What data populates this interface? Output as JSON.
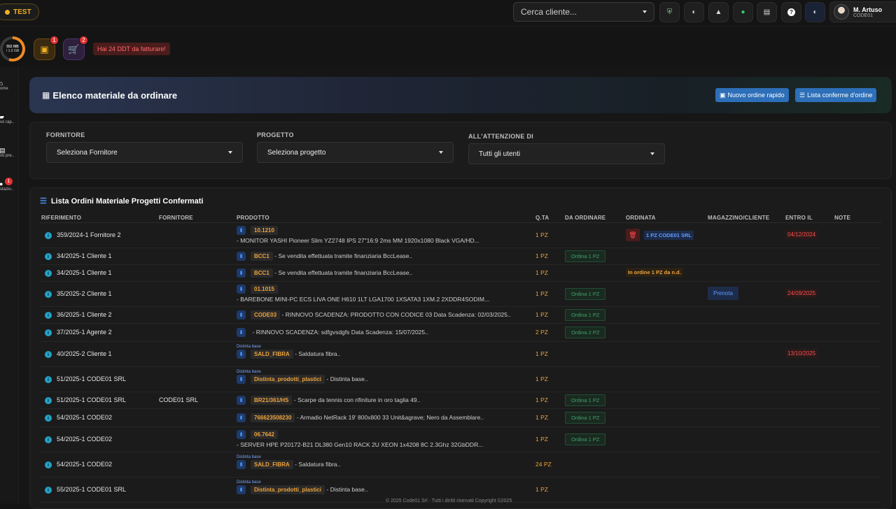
{
  "topbar": {
    "test_label": "TEST",
    "search_placeholder": "Cerca cliente...",
    "user": {
      "name": "M. Artuso",
      "code": "CODE01"
    }
  },
  "storage": {
    "used": "552 MB",
    "total": "/ 1.0 GB"
  },
  "quick": {
    "orders_badge": "1",
    "cart_badge": "2",
    "ddt_alert": "Hai 24 DDT da fatturare!"
  },
  "sidebar": [
    {
      "label": "ome",
      "badge": ""
    },
    {
      "label": "vo rap..",
      "badge": ""
    },
    {
      "label": "vo pre..",
      "badge": ""
    },
    {
      "label": "stazio..",
      "badge": "1"
    }
  ],
  "header": {
    "title": "Elenco materiale da ordinare",
    "btn_new": "Nuovo ordine rapido",
    "btn_list": "Lista conferme d'ordine"
  },
  "filters": {
    "fornitore_label": "FORNITORE",
    "fornitore_value": "Seleziona Fornitore",
    "progetto_label": "PROGETTO",
    "progetto_value": "Seleziona progetto",
    "attenzione_label": "ALL'ATTENZIONE DI",
    "attenzione_value": "Tutti gli utenti"
  },
  "list": {
    "title": "Lista Ordini Materiale Progetti Confermati",
    "columns": [
      "RIFERIMENTO",
      "FORNITORE",
      "PRODOTTO",
      "Q.TA",
      "DA ORDINARE",
      "ORDINATA",
      "MAGAZZINO/CLIENTE",
      "ENTRO IL",
      "NOTE"
    ],
    "rows": [
      {
        "ref": "359/2024-1 Fornitore 2",
        "fornitore": "",
        "distinta": "",
        "code": "10.1210",
        "desc": "- MONITOR YASHI Pioneer Slim YZ2748 IPS 27\"16:9 2ms MM 1920x1080 Black VGA/HD...",
        "qty": "1 PZ",
        "ordina": "",
        "ordinata": "1 PZ CODE01 SRL",
        "magazzino": "",
        "entro": "04/12/2024"
      },
      {
        "ref": "34/2025-1 Cliente 1",
        "fornitore": "",
        "distinta": "",
        "code": "BCC1",
        "desc": "- Se vendita effettuata tramite finanziaria BccLease..",
        "qty": "1 PZ",
        "ordina": "Ordina 1 PZ",
        "ordinata": "",
        "magazzino": "",
        "entro": ""
      },
      {
        "ref": "34/2025-1 Cliente 1",
        "fornitore": "",
        "distinta": "",
        "code": "BCC1",
        "desc": "- Se vendita effettuata tramite finanziaria BccLease..",
        "qty": "1 PZ",
        "ordina": "",
        "ordinata": "In ordine 1 PZ da n.d.",
        "magazzino": "",
        "entro": ""
      },
      {
        "ref": "35/2025-2 Cliente 1",
        "fornitore": "",
        "distinta": "",
        "code": "01.1015",
        "desc": "- BAREBONE MINI-PC ECS LIVA ONE H610 1LT LGA1700 1XSATA3 1XM.2 2XDDR4SODIM...",
        "qty": "1 PZ",
        "ordina": "Ordina 1 PZ",
        "ordinata": "",
        "magazzino": "Prenota",
        "entro": "24/09/2025"
      },
      {
        "ref": "36/2025-1 Cliente 2",
        "fornitore": "",
        "distinta": "",
        "code": "CODE03",
        "desc": "- RINNOVO SCADENZA: PRODOTTO CON CODICE 03 Data Scadenza: 02/03/2025..",
        "qty": "1 PZ",
        "ordina": "Ordina 1 PZ",
        "ordinata": "",
        "magazzino": "",
        "entro": ""
      },
      {
        "ref": "37/2025-1 Agente 2",
        "fornitore": "",
        "distinta": "",
        "code": "",
        "desc": "- RINNOVO SCADENZA: sdfgvsdgfs Data Scadenza: 15/07/2025..",
        "qty": "2 PZ",
        "ordina": "Ordina 2 PZ",
        "ordinata": "",
        "magazzino": "",
        "entro": ""
      },
      {
        "ref": "40/2025-2 Cliente 1",
        "fornitore": "",
        "distinta": "Distinta base",
        "code": "SALD_FIBRA",
        "desc": "- Saldatura fibra..",
        "qty": "1 PZ",
        "ordina": "",
        "ordinata": "",
        "magazzino": "",
        "entro": "13/10/2025"
      },
      {
        "ref": "51/2025-1 CODE01 SRL",
        "fornitore": "",
        "distinta": "Distinta base",
        "code": "Distinta_prodotti_plastici",
        "desc": "- Distinta base..",
        "qty": "1 PZ",
        "ordina": "",
        "ordinata": "",
        "magazzino": "",
        "entro": ""
      },
      {
        "ref": "51/2025-1 CODE01 SRL",
        "fornitore": "CODE01 SRL",
        "distinta": "",
        "code": "BR21/361/HS",
        "desc": "- Scarpe da tennis con rifiniture in oro taglia 49..",
        "qty": "1 PZ",
        "ordina": "Ordina 1 PZ",
        "ordinata": "",
        "magazzino": "",
        "entro": ""
      },
      {
        "ref": "54/2025-1 CODE02",
        "fornitore": "",
        "distinta": "",
        "code": "766623508230",
        "desc": "- Armadio NetRack 19' 800x800 33 Unit&agrave; Nero da Assemblare..",
        "qty": "1 PZ",
        "ordina": "Ordina 1 PZ",
        "ordinata": "",
        "magazzino": "",
        "entro": ""
      },
      {
        "ref": "54/2025-1 CODE02",
        "fornitore": "",
        "distinta": "",
        "code": "06.7642",
        "desc": "- SERVER HPE P20172-B21 DL380 Gen10 RACK 2U XEON 1x4208 8C 2.3Ghz 32GbDDR...",
        "qty": "1 PZ",
        "ordina": "Ordina 1 PZ",
        "ordinata": "",
        "magazzino": "",
        "entro": ""
      },
      {
        "ref": "54/2025-1 CODE02",
        "fornitore": "",
        "distinta": "Distinta base",
        "code": "SALD_FIBRA",
        "desc": "- Saldatura fibra..",
        "qty": "24 PZ",
        "ordina": "",
        "ordinata": "",
        "magazzino": "",
        "entro": ""
      },
      {
        "ref": "55/2025-1 CODE01 SRL",
        "fornitore": "",
        "distinta": "Distinta base",
        "code": "Distinta_prodotti_plastici",
        "desc": "- Distinta base..",
        "qty": "1 PZ",
        "ordina": "",
        "ordinata": "",
        "magazzino": "",
        "entro": ""
      }
    ]
  },
  "footer": "© 2025 Code01 Srl - Tutti i diritti riservati Copyright ©2025"
}
